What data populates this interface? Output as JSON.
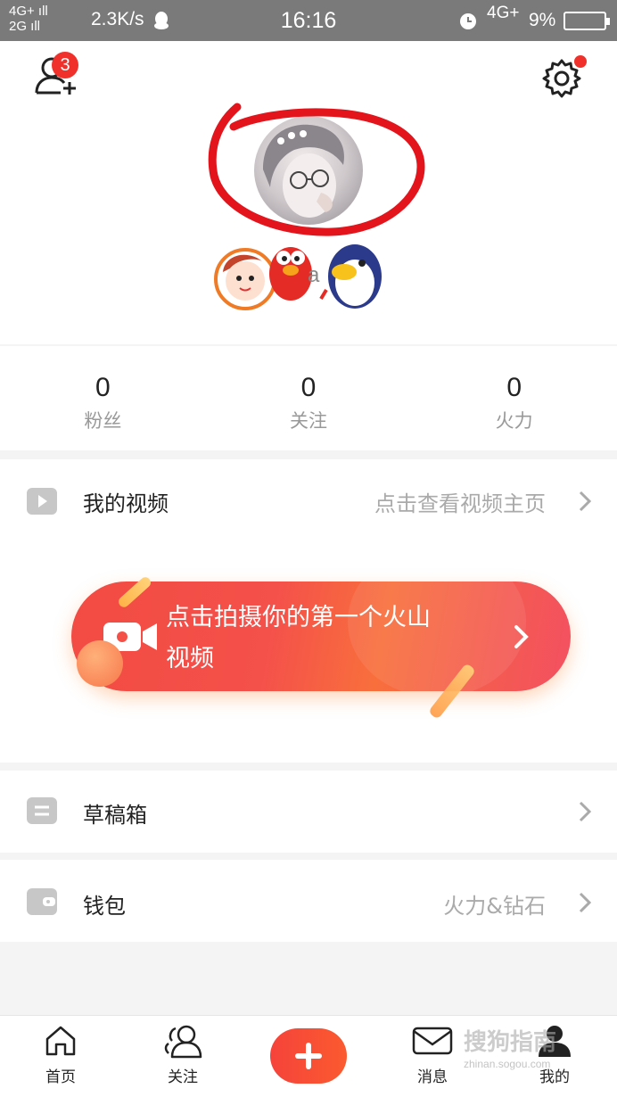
{
  "status_bar": {
    "network_top": "4G+ ıll",
    "network_bottom": "2G ıll",
    "speed": "2.3K/s",
    "time": "16:16",
    "network_right": "4G+",
    "battery": "9%"
  },
  "header": {
    "friend_badge": "3",
    "nickname_fragment": "a"
  },
  "stats": [
    {
      "value": "0",
      "label": "粉丝"
    },
    {
      "value": "0",
      "label": "关注"
    },
    {
      "value": "0",
      "label": "火力"
    }
  ],
  "menu": {
    "my_videos": {
      "label": "我的视频",
      "hint": "点击查看视频主页"
    },
    "cta": {
      "line1": "点击拍摄你的第一个火山",
      "line2": "视频"
    },
    "drafts": {
      "label": "草稿箱"
    },
    "wallet": {
      "label": "钱包",
      "hint": "火力&钻石"
    }
  },
  "tabbar": {
    "home": "首页",
    "follow": "关注",
    "messages": "消息",
    "me": "我的"
  },
  "watermark": {
    "main": "搜狗指南",
    "sub": "zhinan.sogou.com"
  },
  "colors": {
    "accent": "#f0312b",
    "cta_start": "#f24b43",
    "cta_end": "#f35061"
  }
}
